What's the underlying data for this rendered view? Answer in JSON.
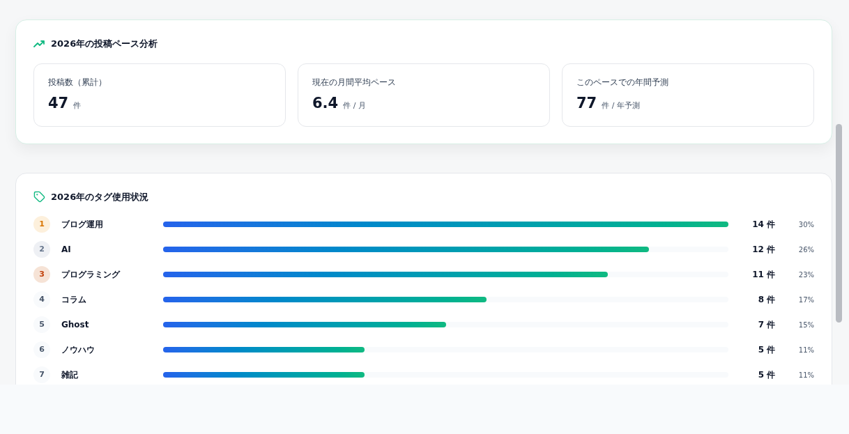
{
  "pace_card": {
    "title": "2026年の投稿ペース分析",
    "stats": [
      {
        "label": "投稿数（累計）",
        "value": "47",
        "unit": "件"
      },
      {
        "label": "現在の月間平均ペース",
        "value": "6.4",
        "unit": "件 / 月"
      },
      {
        "label": "このペースでの年間予測",
        "value": "77",
        "unit": "件 / 年予測"
      }
    ]
  },
  "tag_card": {
    "title": "2026年のタグ使用状況",
    "rows": [
      {
        "rank": "1",
        "kind": "gold",
        "name": "ブログ運用",
        "level": 1.0,
        "count": "14 件",
        "percent": "30%"
      },
      {
        "rank": "2",
        "kind": "silver",
        "name": "AI",
        "level": 0.859,
        "count": "12 件",
        "percent": "26%"
      },
      {
        "rank": "3",
        "kind": "bronze",
        "name": "プログラミング",
        "level": 0.786,
        "count": "11 件",
        "percent": "23%"
      },
      {
        "rank": "4",
        "kind": "plain",
        "name": "コラム",
        "level": 0.572,
        "count": "8 件",
        "percent": "17%"
      },
      {
        "rank": "5",
        "kind": "plain",
        "name": "Ghost",
        "level": 0.501,
        "count": "7 件",
        "percent": "15%"
      },
      {
        "rank": "6",
        "kind": "plain",
        "name": "ノウハウ",
        "level": 0.357,
        "count": "5 件",
        "percent": "11%"
      },
      {
        "rank": "7",
        "kind": "plain",
        "name": "雑記",
        "level": 0.357,
        "count": "5 件",
        "percent": "11%"
      }
    ]
  }
}
